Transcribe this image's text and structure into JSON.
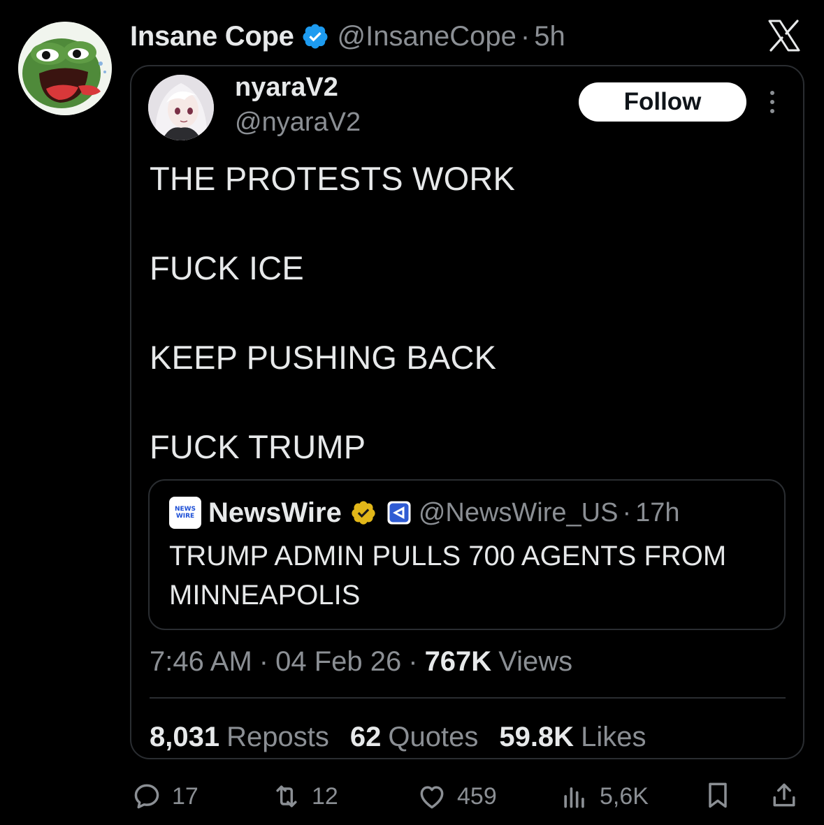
{
  "outer": {
    "name": "Insane Cope",
    "handle": "@InsaneCope",
    "separator": "·",
    "time": "5h"
  },
  "quote": {
    "name": "nyaraV2",
    "handle": "@nyaraV2",
    "follow_label": "Follow",
    "lines": [
      "THE PROTESTS WORK",
      "FUCK ICE",
      "KEEP PUSHING BACK",
      "FUCK TRUMP"
    ],
    "nested": {
      "logo_line1": "NEWS",
      "logo_line2": "WIRE",
      "name": "NewsWire",
      "handle": "@NewsWire_US",
      "separator": "·",
      "time": "17h",
      "text": "TRUMP ADMIN PULLS 700 AGENTS FROM MINNEAPOLIS"
    },
    "meta": {
      "time": "7:46 AM",
      "date": "04 Feb 26",
      "separator": "·",
      "views_count": "767K",
      "views_label": "Views"
    },
    "stats": {
      "reposts_count": "8,031",
      "reposts_label": "Reposts",
      "quotes_count": "62",
      "quotes_label": "Quotes",
      "likes_count": "59.8K",
      "likes_label": "Likes"
    }
  },
  "actions": {
    "replies": "17",
    "reposts": "12",
    "likes": "459",
    "views": "5,6K"
  },
  "colors": {
    "background": "#000000",
    "text": "#e7e9ea",
    "muted": "#8b8f94",
    "border": "#2a2d31",
    "verified_blue": "#1d9bf0",
    "verified_gold": "#e2b719"
  }
}
